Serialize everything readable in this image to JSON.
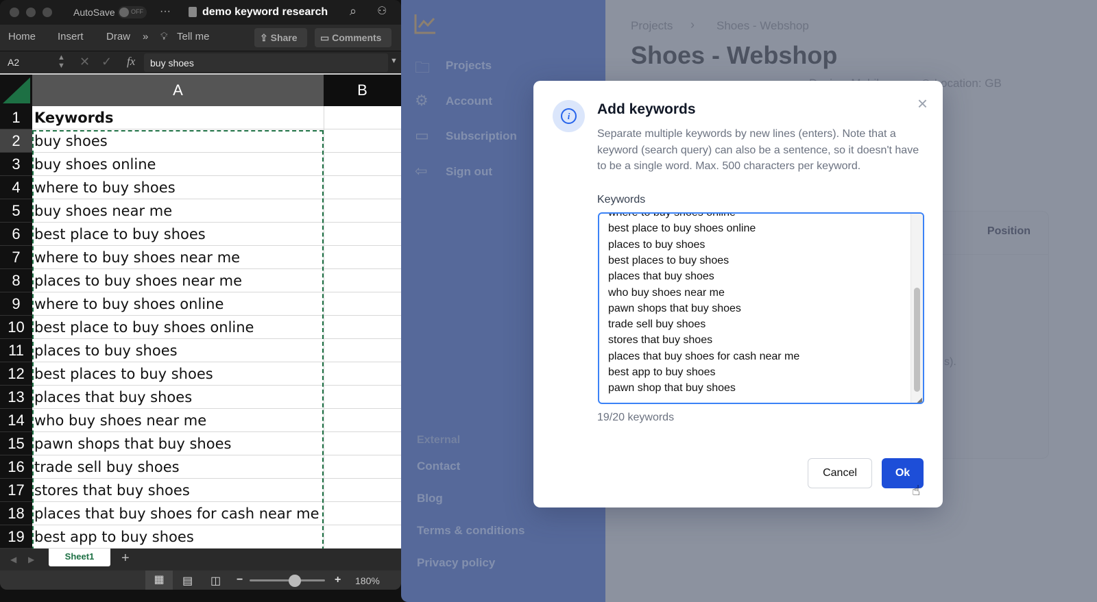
{
  "excel": {
    "autosave": "AutoSave",
    "autosave_state": "OFF",
    "more": "···",
    "doc_title": "demo keyword research",
    "ribbon_tabs": [
      "Home",
      "Insert",
      "Draw"
    ],
    "overflow": "»",
    "tell_me": "Tell me",
    "share": "Share",
    "comments": "Comments",
    "name_box": "A2",
    "fx": "fx",
    "formula_value": "buy shoes",
    "col_a": "A",
    "col_b": "B",
    "rows": [
      "Keywords",
      "buy shoes",
      "buy shoes online",
      "where to buy shoes",
      "buy shoes near me",
      "best place to buy shoes",
      "where to buy shoes near me",
      "places to buy shoes near me",
      "where to buy shoes online",
      "best place to buy shoes online",
      "places to buy shoes",
      "best places to buy shoes",
      "places that buy shoes",
      "who buy shoes near me",
      "pawn shops that buy shoes",
      "trade sell buy shoes",
      "stores that buy shoes",
      "places that buy shoes for cash near me",
      "best app to buy shoes"
    ],
    "sheet_tab": "Sheet1",
    "add_sheet": "+",
    "zoom": "180%",
    "zoom_minus": "−",
    "zoom_plus": "+",
    "zoom_level": 0.6,
    "accent": "#1d7044"
  },
  "sidebar": {
    "items": [
      {
        "label": "Projects",
        "icon": "folder-icon"
      },
      {
        "label": "Account",
        "icon": "gear-icon"
      },
      {
        "label": "Subscription",
        "icon": "credit-card-icon"
      },
      {
        "label": "Sign out",
        "icon": "sign-out-icon"
      }
    ],
    "external_heading": "External",
    "links": [
      "Contact",
      "Blog",
      "Terms & conditions",
      "Privacy policy"
    ]
  },
  "page": {
    "breadcrumb": [
      "Projects",
      "Shoes - Webshop"
    ],
    "title": "Shoes - Webshop",
    "meta_device": "Device: Mobile",
    "meta_location": "Location: GB",
    "table_header_position": "Position",
    "partial_text": "s)."
  },
  "modal": {
    "title": "Add keywords",
    "description": "Separate multiple keywords by new lines (enters). Note that a keyword (search query) can also be a sentence, so it doesn't have to be a single word. Max. 500 characters per keyword.",
    "field_label": "Keywords",
    "keywords_visible": [
      "where to buy shoes online",
      "best place to buy shoes online",
      "places to buy shoes",
      "best places to buy shoes",
      "places that buy shoes",
      "who buy shoes near me",
      "pawn shops that buy shoes",
      "trade sell buy shoes",
      "stores that buy shoes",
      "places that buy shoes for cash near me",
      "best app to buy shoes",
      "pawn shop that buy shoes"
    ],
    "count": "19/20 keywords",
    "cancel": "Cancel",
    "ok": "Ok",
    "primary_color": "#1d4ed8"
  }
}
